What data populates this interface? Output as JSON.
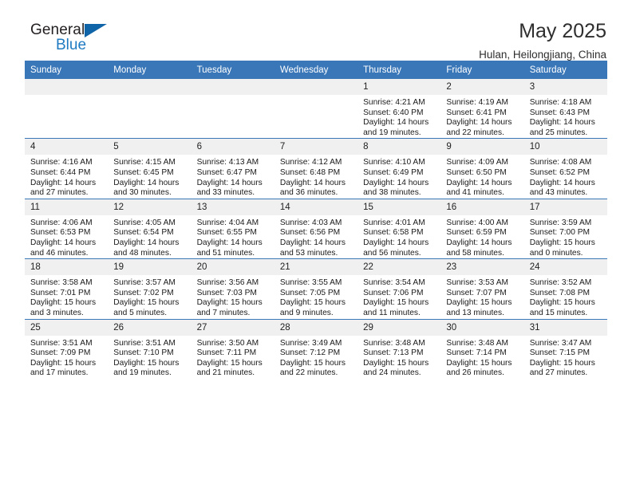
{
  "logo": {
    "word_primary": "General",
    "word_secondary": "Blue",
    "triangle_color": "#1064A8",
    "secondary_color": "#1F7BC1"
  },
  "header": {
    "title": "May 2025",
    "subtitle": "Hulan, Heilongjiang, China"
  },
  "theme": {
    "header_blue": "#3A77B8",
    "daynum_band": "#F0F0F0"
  },
  "columns": [
    "Sunday",
    "Monday",
    "Tuesday",
    "Wednesday",
    "Thursday",
    "Friday",
    "Saturday"
  ],
  "weeks": [
    [
      {
        "day": "",
        "empty": true
      },
      {
        "day": "",
        "empty": true
      },
      {
        "day": "",
        "empty": true
      },
      {
        "day": "",
        "empty": true
      },
      {
        "day": "1",
        "sunrise": "Sunrise: 4:21 AM",
        "sunset": "Sunset: 6:40 PM",
        "daylight_line1": "Daylight: 14 hours",
        "daylight_line2": "and 19 minutes."
      },
      {
        "day": "2",
        "sunrise": "Sunrise: 4:19 AM",
        "sunset": "Sunset: 6:41 PM",
        "daylight_line1": "Daylight: 14 hours",
        "daylight_line2": "and 22 minutes."
      },
      {
        "day": "3",
        "sunrise": "Sunrise: 4:18 AM",
        "sunset": "Sunset: 6:43 PM",
        "daylight_line1": "Daylight: 14 hours",
        "daylight_line2": "and 25 minutes."
      }
    ],
    [
      {
        "day": "4",
        "sunrise": "Sunrise: 4:16 AM",
        "sunset": "Sunset: 6:44 PM",
        "daylight_line1": "Daylight: 14 hours",
        "daylight_line2": "and 27 minutes."
      },
      {
        "day": "5",
        "sunrise": "Sunrise: 4:15 AM",
        "sunset": "Sunset: 6:45 PM",
        "daylight_line1": "Daylight: 14 hours",
        "daylight_line2": "and 30 minutes."
      },
      {
        "day": "6",
        "sunrise": "Sunrise: 4:13 AM",
        "sunset": "Sunset: 6:47 PM",
        "daylight_line1": "Daylight: 14 hours",
        "daylight_line2": "and 33 minutes."
      },
      {
        "day": "7",
        "sunrise": "Sunrise: 4:12 AM",
        "sunset": "Sunset: 6:48 PM",
        "daylight_line1": "Daylight: 14 hours",
        "daylight_line2": "and 36 minutes."
      },
      {
        "day": "8",
        "sunrise": "Sunrise: 4:10 AM",
        "sunset": "Sunset: 6:49 PM",
        "daylight_line1": "Daylight: 14 hours",
        "daylight_line2": "and 38 minutes."
      },
      {
        "day": "9",
        "sunrise": "Sunrise: 4:09 AM",
        "sunset": "Sunset: 6:50 PM",
        "daylight_line1": "Daylight: 14 hours",
        "daylight_line2": "and 41 minutes."
      },
      {
        "day": "10",
        "sunrise": "Sunrise: 4:08 AM",
        "sunset": "Sunset: 6:52 PM",
        "daylight_line1": "Daylight: 14 hours",
        "daylight_line2": "and 43 minutes."
      }
    ],
    [
      {
        "day": "11",
        "sunrise": "Sunrise: 4:06 AM",
        "sunset": "Sunset: 6:53 PM",
        "daylight_line1": "Daylight: 14 hours",
        "daylight_line2": "and 46 minutes."
      },
      {
        "day": "12",
        "sunrise": "Sunrise: 4:05 AM",
        "sunset": "Sunset: 6:54 PM",
        "daylight_line1": "Daylight: 14 hours",
        "daylight_line2": "and 48 minutes."
      },
      {
        "day": "13",
        "sunrise": "Sunrise: 4:04 AM",
        "sunset": "Sunset: 6:55 PM",
        "daylight_line1": "Daylight: 14 hours",
        "daylight_line2": "and 51 minutes."
      },
      {
        "day": "14",
        "sunrise": "Sunrise: 4:03 AM",
        "sunset": "Sunset: 6:56 PM",
        "daylight_line1": "Daylight: 14 hours",
        "daylight_line2": "and 53 minutes."
      },
      {
        "day": "15",
        "sunrise": "Sunrise: 4:01 AM",
        "sunset": "Sunset: 6:58 PM",
        "daylight_line1": "Daylight: 14 hours",
        "daylight_line2": "and 56 minutes."
      },
      {
        "day": "16",
        "sunrise": "Sunrise: 4:00 AM",
        "sunset": "Sunset: 6:59 PM",
        "daylight_line1": "Daylight: 14 hours",
        "daylight_line2": "and 58 minutes."
      },
      {
        "day": "17",
        "sunrise": "Sunrise: 3:59 AM",
        "sunset": "Sunset: 7:00 PM",
        "daylight_line1": "Daylight: 15 hours",
        "daylight_line2": "and 0 minutes."
      }
    ],
    [
      {
        "day": "18",
        "sunrise": "Sunrise: 3:58 AM",
        "sunset": "Sunset: 7:01 PM",
        "daylight_line1": "Daylight: 15 hours",
        "daylight_line2": "and 3 minutes."
      },
      {
        "day": "19",
        "sunrise": "Sunrise: 3:57 AM",
        "sunset": "Sunset: 7:02 PM",
        "daylight_line1": "Daylight: 15 hours",
        "daylight_line2": "and 5 minutes."
      },
      {
        "day": "20",
        "sunrise": "Sunrise: 3:56 AM",
        "sunset": "Sunset: 7:03 PM",
        "daylight_line1": "Daylight: 15 hours",
        "daylight_line2": "and 7 minutes."
      },
      {
        "day": "21",
        "sunrise": "Sunrise: 3:55 AM",
        "sunset": "Sunset: 7:05 PM",
        "daylight_line1": "Daylight: 15 hours",
        "daylight_line2": "and 9 minutes."
      },
      {
        "day": "22",
        "sunrise": "Sunrise: 3:54 AM",
        "sunset": "Sunset: 7:06 PM",
        "daylight_line1": "Daylight: 15 hours",
        "daylight_line2": "and 11 minutes."
      },
      {
        "day": "23",
        "sunrise": "Sunrise: 3:53 AM",
        "sunset": "Sunset: 7:07 PM",
        "daylight_line1": "Daylight: 15 hours",
        "daylight_line2": "and 13 minutes."
      },
      {
        "day": "24",
        "sunrise": "Sunrise: 3:52 AM",
        "sunset": "Sunset: 7:08 PM",
        "daylight_line1": "Daylight: 15 hours",
        "daylight_line2": "and 15 minutes."
      }
    ],
    [
      {
        "day": "25",
        "sunrise": "Sunrise: 3:51 AM",
        "sunset": "Sunset: 7:09 PM",
        "daylight_line1": "Daylight: 15 hours",
        "daylight_line2": "and 17 minutes."
      },
      {
        "day": "26",
        "sunrise": "Sunrise: 3:51 AM",
        "sunset": "Sunset: 7:10 PM",
        "daylight_line1": "Daylight: 15 hours",
        "daylight_line2": "and 19 minutes."
      },
      {
        "day": "27",
        "sunrise": "Sunrise: 3:50 AM",
        "sunset": "Sunset: 7:11 PM",
        "daylight_line1": "Daylight: 15 hours",
        "daylight_line2": "and 21 minutes."
      },
      {
        "day": "28",
        "sunrise": "Sunrise: 3:49 AM",
        "sunset": "Sunset: 7:12 PM",
        "daylight_line1": "Daylight: 15 hours",
        "daylight_line2": "and 22 minutes."
      },
      {
        "day": "29",
        "sunrise": "Sunrise: 3:48 AM",
        "sunset": "Sunset: 7:13 PM",
        "daylight_line1": "Daylight: 15 hours",
        "daylight_line2": "and 24 minutes."
      },
      {
        "day": "30",
        "sunrise": "Sunrise: 3:48 AM",
        "sunset": "Sunset: 7:14 PM",
        "daylight_line1": "Daylight: 15 hours",
        "daylight_line2": "and 26 minutes."
      },
      {
        "day": "31",
        "sunrise": "Sunrise: 3:47 AM",
        "sunset": "Sunset: 7:15 PM",
        "daylight_line1": "Daylight: 15 hours",
        "daylight_line2": "and 27 minutes."
      }
    ]
  ]
}
